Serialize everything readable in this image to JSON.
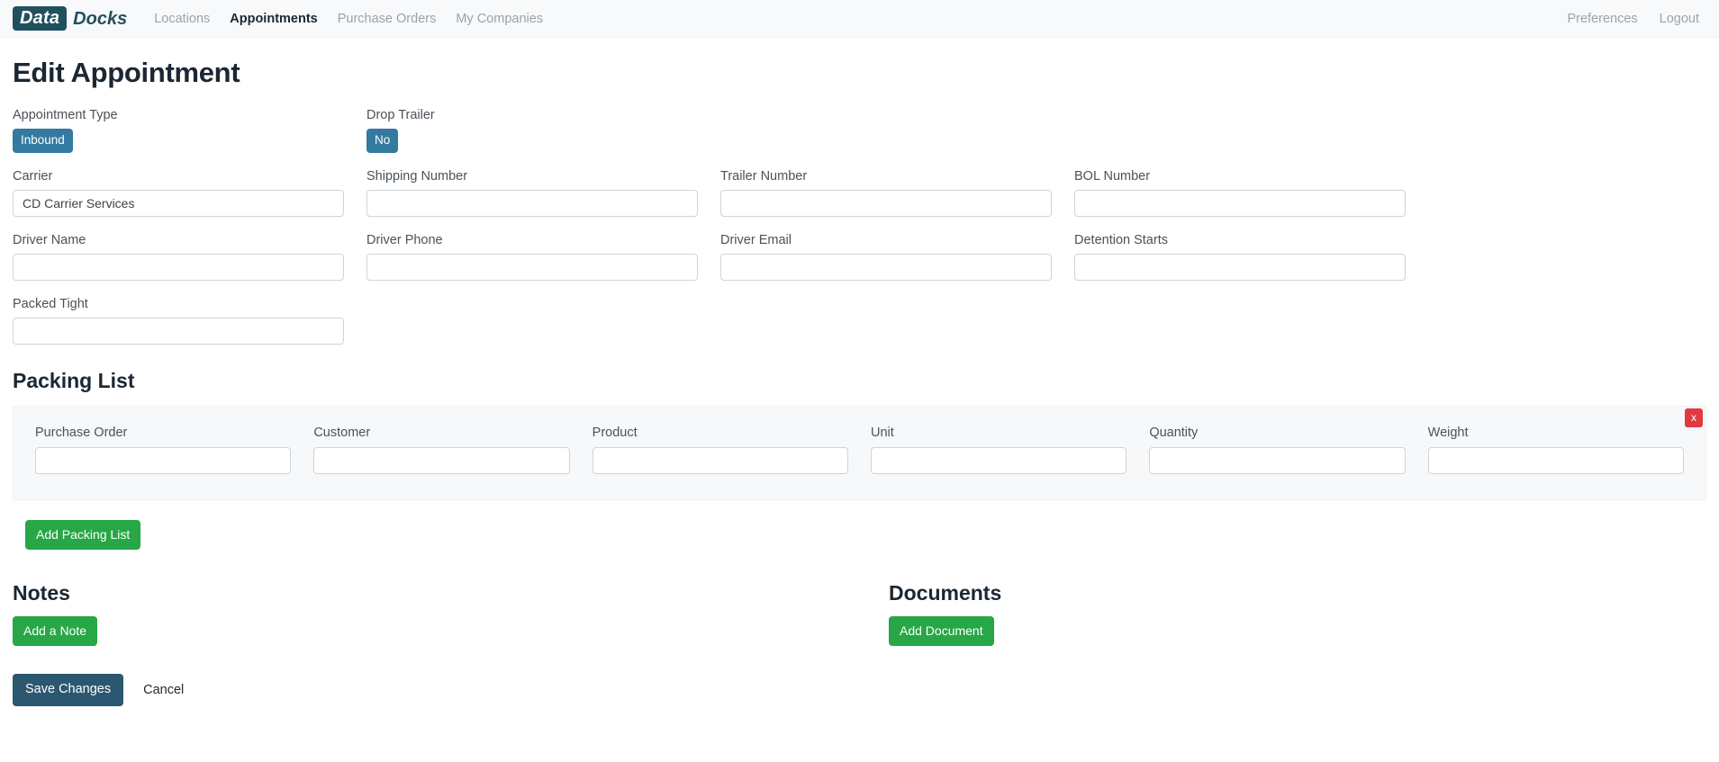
{
  "navbar": {
    "brand_box": "Data",
    "brand_word": "Docks",
    "links": [
      {
        "label": "Locations",
        "active": false
      },
      {
        "label": "Appointments",
        "active": true
      },
      {
        "label": "Purchase Orders",
        "active": false
      },
      {
        "label": "My Companies",
        "active": false
      }
    ],
    "right_links": [
      {
        "label": "Preferences"
      },
      {
        "label": "Logout"
      }
    ]
  },
  "page": {
    "title": "Edit Appointment"
  },
  "form": {
    "appointment_type": {
      "label": "Appointment Type",
      "value": "Inbound"
    },
    "drop_trailer": {
      "label": "Drop Trailer",
      "value": "No"
    },
    "row1": [
      {
        "label": "Carrier",
        "value": "CD Carrier Services",
        "placeholder": ""
      },
      {
        "label": "Shipping Number",
        "value": "",
        "placeholder": ""
      },
      {
        "label": "Trailer Number",
        "value": "",
        "placeholder": ""
      },
      {
        "label": "BOL Number",
        "value": "",
        "placeholder": ""
      }
    ],
    "row2": [
      {
        "label": "Driver Name",
        "value": "",
        "placeholder": ""
      },
      {
        "label": "Driver Phone",
        "value": "",
        "placeholder": ""
      },
      {
        "label": "Driver Email",
        "value": "",
        "placeholder": ""
      },
      {
        "label": "Detention Starts",
        "value": "",
        "placeholder": ""
      }
    ],
    "row3": [
      {
        "label": "Packed Tight",
        "value": "",
        "placeholder": ""
      }
    ]
  },
  "packing_list": {
    "title": "Packing List",
    "remove_label": "x",
    "columns": [
      {
        "label": "Purchase Order",
        "value": "",
        "placeholder": ""
      },
      {
        "label": "Customer",
        "value": "",
        "placeholder": ""
      },
      {
        "label": "Product",
        "value": "",
        "placeholder": ""
      },
      {
        "label": "Unit",
        "value": "",
        "placeholder": ""
      },
      {
        "label": "Quantity",
        "value": "",
        "placeholder": ""
      },
      {
        "label": "Weight",
        "value": "",
        "placeholder": ""
      }
    ],
    "add_label": "Add Packing List"
  },
  "notes": {
    "title": "Notes",
    "add_label": "Add a Note"
  },
  "documents": {
    "title": "Documents",
    "add_label": "Add Document"
  },
  "footer": {
    "save_label": "Save Changes",
    "cancel_label": "Cancel"
  },
  "colors": {
    "brand": "#21505f",
    "badge": "#3479a0",
    "green": "#27a745",
    "danger": "#e03a3f",
    "save": "#2c5770"
  }
}
